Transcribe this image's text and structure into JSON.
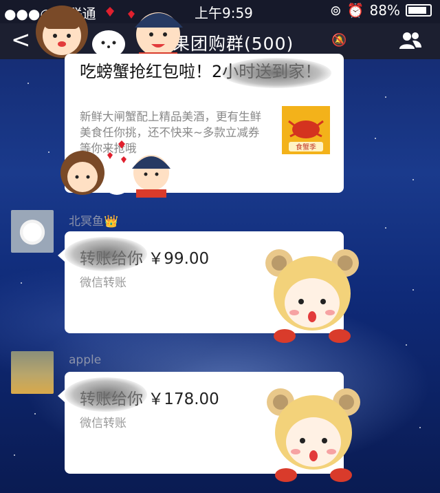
{
  "status_bar": {
    "carrier": "●●●○○ 联通",
    "time": "上午9:59",
    "battery": "88%"
  },
  "nav": {
    "back_label": "<",
    "title": "鲜果团购群(500)"
  },
  "messages": {
    "card": {
      "title": "吃螃蟹抢红包啦！2小时送到家！",
      "description": "新鲜大闸蟹配上精品美酒，更有生鲜美食任你挑，还不快来~多款立减券等你来抢哦",
      "thumb_label": "食蟹季"
    },
    "transfer_1": {
      "sender": "北冥鱼👑",
      "amount_text": "转账给你 ￥99.00",
      "subtitle": "微信转账"
    },
    "transfer_2": {
      "sender": "apple",
      "amount_text": "转账给你 ￥178.00",
      "subtitle": "微信转账"
    }
  },
  "colors": {
    "navbar": "#1c1f30",
    "background": "#13276a",
    "bubble": "#ffffff",
    "thumb": "#f3b21a"
  }
}
